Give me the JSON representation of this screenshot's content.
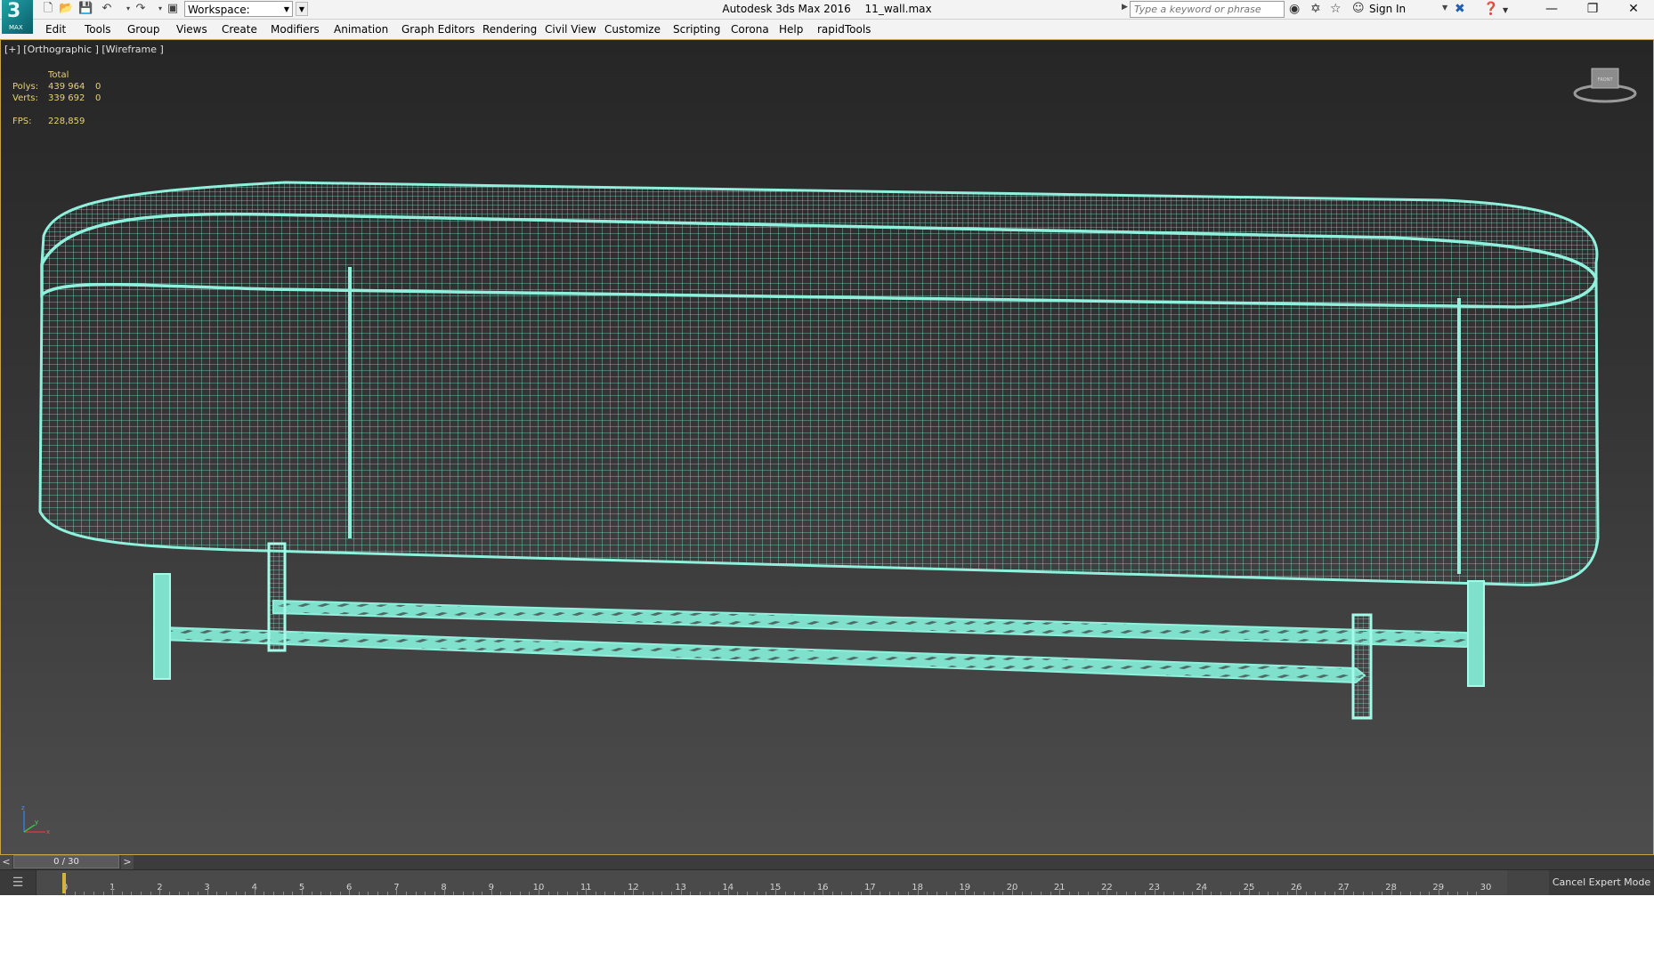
{
  "app": {
    "logo_label": "MAX",
    "title": "Autodesk 3ds Max 2016",
    "file_name": "11_wall.max"
  },
  "toolbar": {
    "workspace_value": "Workspace: Default",
    "search_placeholder": "Type a keyword or phrase",
    "sign_in_label": "Sign In"
  },
  "menu": [
    "Edit",
    "Tools",
    "Group",
    "Views",
    "Create",
    "Modifiers",
    "Animation",
    "Graph Editors",
    "Rendering",
    "Civil View",
    "Customize",
    "Scripting",
    "Corona",
    "Help",
    "rapidTools"
  ],
  "viewport": {
    "label": "[+] [Orthographic ] [Wireframe ]",
    "stats": {
      "header": "Total",
      "polys_label": "Polys:",
      "polys_value": "439 964",
      "polys_sel": "0",
      "verts_label": "Verts:",
      "verts_value": "339 692",
      "verts_sel": "0",
      "fps_label": "FPS:",
      "fps_value": "228,859"
    },
    "viewcube_label": "FRONT",
    "axis_labels": {
      "z": "z",
      "x": "x",
      "y": "y"
    },
    "wire_color": "#7fe0cc"
  },
  "timeline": {
    "slider_value": "0 / 30",
    "prev_label": "<",
    "next_label": ">",
    "frames": [
      "0",
      "1",
      "2",
      "3",
      "4",
      "5",
      "6",
      "7",
      "8",
      "9",
      "10",
      "11",
      "12",
      "13",
      "14",
      "15",
      "16",
      "17",
      "18",
      "19",
      "20",
      "21",
      "22",
      "23",
      "24",
      "25",
      "26",
      "27",
      "28",
      "29",
      "30"
    ],
    "cancel_expert_label": "Cancel Expert Mode"
  }
}
